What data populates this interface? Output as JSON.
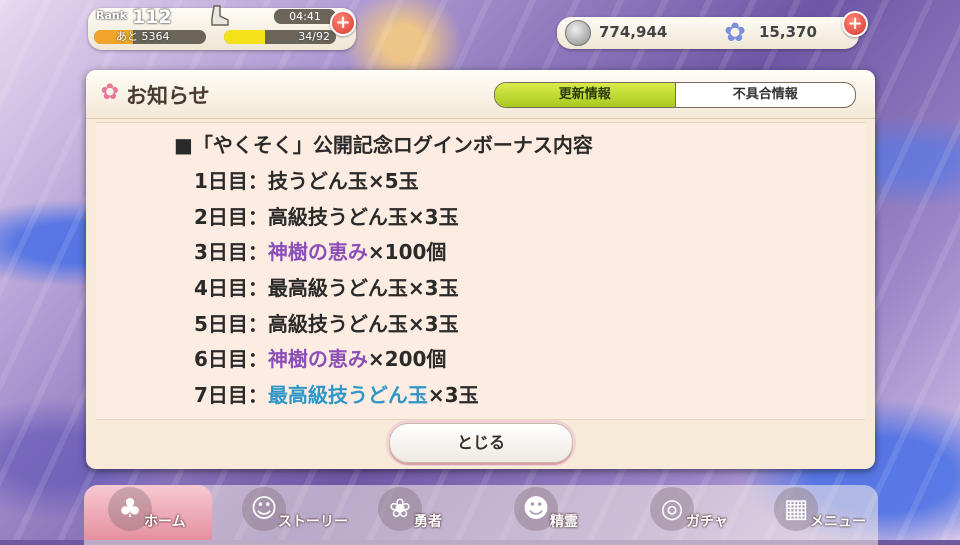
{
  "hud": {
    "rank_label": "Rank",
    "rank_value": "112",
    "exp_remaining": "あと 5364",
    "exp_fraction": 0.35,
    "stamina_timer": "04:41",
    "stamina_text": "34/92",
    "stamina_fraction": 0.37,
    "coins": "774,944",
    "flowers": "15,370",
    "plus_icon": "plus-icon",
    "accent_red": "#d8342c"
  },
  "modal": {
    "title": "お知らせ",
    "tabs": [
      {
        "label": "更新情報",
        "active": true
      },
      {
        "label": "不具合情報",
        "active": false
      }
    ],
    "content_title": "■「やくそく」公開記念ログインボーナス内容",
    "lines": [
      {
        "day": "1日目：",
        "item": "",
        "plain": "技うどん玉×5玉",
        "color": "normal"
      },
      {
        "day": "2日目：",
        "item": "",
        "plain": "高級技うどん玉×3玉",
        "color": "normal"
      },
      {
        "day": "3日目：",
        "item": "神樹の恵み",
        "plain": "×100個",
        "color": "purple"
      },
      {
        "day": "4日目：",
        "item": "",
        "plain": "最高級うどん玉×3玉",
        "color": "normal"
      },
      {
        "day": "5日目：",
        "item": "",
        "plain": "高級技うどん玉×3玉",
        "color": "normal"
      },
      {
        "day": "6日目：",
        "item": "神樹の恵み",
        "plain": "×200個",
        "color": "purple"
      },
      {
        "day": "7日目：",
        "item": "最高級技うどん玉",
        "plain": "×3玉",
        "color": "blue"
      }
    ],
    "close_label": "とじる",
    "tab_active_color": "#a9c920",
    "purple_text": "#8a4fb8",
    "blue_text": "#2f96c8"
  },
  "nav": {
    "items": [
      {
        "label": "ホーム",
        "icon": "home-icon",
        "active": true
      },
      {
        "label": "ストーリー",
        "icon": "story-icon",
        "active": false
      },
      {
        "label": "勇者",
        "icon": "hero-icon",
        "active": false
      },
      {
        "label": "精霊",
        "icon": "spirit-icon",
        "active": false
      },
      {
        "label": "ガチャ",
        "icon": "gacha-icon",
        "active": false
      },
      {
        "label": "メニュー",
        "icon": "menu-icon",
        "active": false
      }
    ]
  }
}
